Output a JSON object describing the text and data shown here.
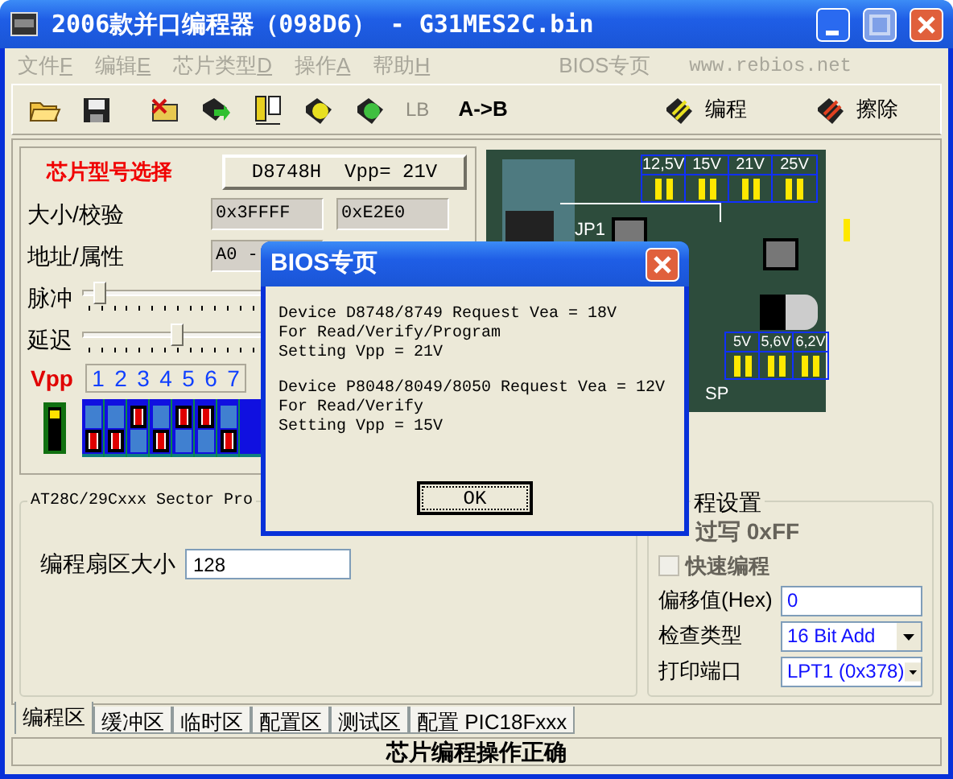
{
  "window": {
    "title": "2006款并口编程器（098D6） - G31MES2C.bin"
  },
  "menu": [
    {
      "label": "文件",
      "key": "F"
    },
    {
      "label": "编辑",
      "key": "E"
    },
    {
      "label": "芯片类型",
      "key": "D"
    },
    {
      "label": "操作",
      "key": "A"
    },
    {
      "label": "帮助",
      "key": "H"
    }
  ],
  "menu_extra": [
    "BIOS专页",
    "www.rebios.net"
  ],
  "toolbar": {
    "lb": {
      "label": "LB",
      "disabled": true
    },
    "swap": "A->B",
    "program_button": "编程",
    "erase_button": "擦除"
  },
  "chip": {
    "label": "芯片型号选择",
    "button": "D8748H  Vpp= 21V"
  },
  "size_row": {
    "label": "大小/校验",
    "values": [
      "0x3FFFF",
      "0xE2E0"
    ]
  },
  "address_row": {
    "label": "地址/属性",
    "value": "A0 -"
  },
  "sliders": [
    {
      "label": "脉冲",
      "level": 0.03
    },
    {
      "label": "延迟",
      "level": 0.24
    }
  ],
  "vpp": {
    "label": "Vpp",
    "numbers": [
      "1",
      "2",
      "3",
      "4",
      "5",
      "6",
      "7"
    ]
  },
  "switches": [
    {
      "on": false
    },
    {
      "on": false
    },
    {
      "on": true
    },
    {
      "on": false
    },
    {
      "on": true
    },
    {
      "on": true
    },
    {
      "on": false
    }
  ],
  "board": {
    "top_labels": [
      "12,5V",
      "15V",
      "21V",
      "25V"
    ],
    "bottom_labels": [
      "5V",
      "5,6V",
      "6,2V"
    ],
    "jp1": "JP1",
    "sp": "SP"
  },
  "sector_group": {
    "title": "AT28C/29Cxxx Sector Pro",
    "label": "编程扇区大小",
    "value": "128"
  },
  "settings_group": {
    "title": "程设置",
    "options": [
      {
        "label": "过写 0xFF",
        "disabled": true
      },
      {
        "label": "快速编程",
        "checked": false,
        "disabled": true
      }
    ],
    "offset": {
      "label": "偏移值(Hex)",
      "value": "0"
    },
    "check_type": {
      "label": "检查类型",
      "value": "16 Bit Add"
    },
    "port": {
      "label": "打印端口",
      "value": "LPT1 (0x378)"
    }
  },
  "tabs": [
    {
      "label": "编程区",
      "selected": true
    },
    {
      "label": "缓冲区",
      "selected": false
    },
    {
      "label": "临时区",
      "selected": false
    },
    {
      "label": "配置区",
      "selected": false
    },
    {
      "label": "测试区",
      "selected": false
    },
    {
      "label": "配置 PIC18Fxxx",
      "selected": false
    }
  ],
  "status_bar": "芯片编程操作正确",
  "dialog": {
    "title": "BIOS专页",
    "paragraphs": [
      "Device D8748/8749 Request Vea = 18V\nFor Read/Verify/Program\nSetting Vpp = 21V",
      "Device P8048/8049/8050 Request Vea = 12V\nFor Read/Verify\nSetting Vpp = 15V"
    ],
    "ok": "OK"
  }
}
